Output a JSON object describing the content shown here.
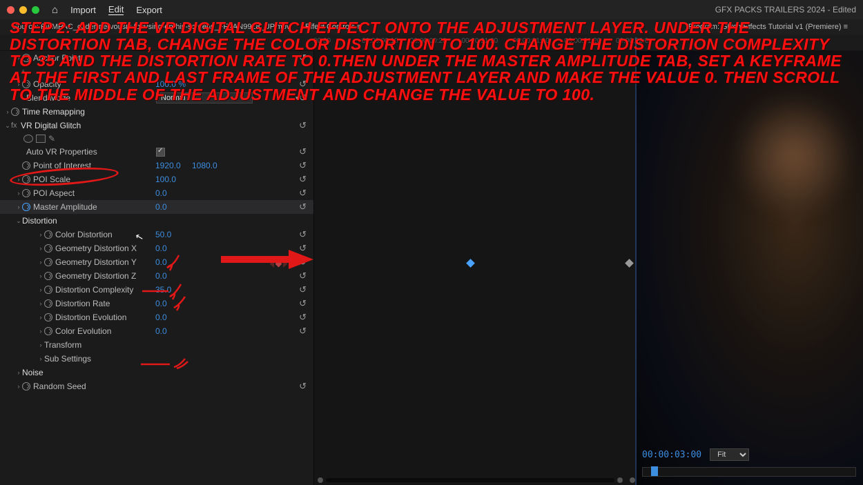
{
  "menu": {
    "import": "Import",
    "edit": "Edit",
    "export": "Export"
  },
  "docTitle": "GFX PACKS TRAILERS 2024 - Edited",
  "panels": {
    "source": "Source: FILMPAC_coder-nervously-focusing-on-his-screens_FFAAN9928_UP.mov",
    "effectControls": "Effect Controls ≡",
    "program": "Program: Glitch Effects Tutorial v1 (Premiere) ≡"
  },
  "ruler": [
    "00:00",
    "00:00:00:10",
    "00:00:00:20",
    "00:00:01:00",
    "00:00:01:10",
    "00:00:01:20",
    "00:00:02:0"
  ],
  "props": {
    "anchorPoint": "Anchor Point",
    "opacity": {
      "label": "Opacity",
      "value": "100.0 %"
    },
    "blendMode": {
      "label": "Blend Mode",
      "value": "Normal"
    },
    "timeRemap": "Time Remapping",
    "vrGlitch": "VR Digital Glitch",
    "autoVR": "Auto VR Properties",
    "poi": {
      "label": "Point of Interest",
      "x": "1920.0",
      "y": "1080.0"
    },
    "poiScale": {
      "label": "POI Scale",
      "value": "100.0"
    },
    "poiAspect": {
      "label": "POI Aspect",
      "value": "0.0"
    },
    "masterAmp": {
      "label": "Master Amplitude",
      "value": "0.0"
    },
    "distortion": "Distortion",
    "colorDist": {
      "label": "Color Distortion",
      "value": "50.0"
    },
    "geoX": {
      "label": "Geometry Distortion X",
      "value": "0.0"
    },
    "geoY": {
      "label": "Geometry Distortion Y",
      "value": "0.0"
    },
    "geoZ": {
      "label": "Geometry Distortion Z",
      "value": "0.0"
    },
    "distComp": {
      "label": "Distortion Complexity",
      "value": "35.0"
    },
    "distRate": {
      "label": "Distortion Rate",
      "value": "0.0"
    },
    "distEvo": {
      "label": "Distortion Evolution",
      "value": "0.0"
    },
    "colorEvo": {
      "label": "Color Evolution",
      "value": "0.0"
    },
    "transform": "Transform",
    "subSettings": "Sub Settings",
    "noise": "Noise",
    "randomSeed": "Random Seed"
  },
  "preview": {
    "timecode": "00:00:03:00",
    "fit": "Fit"
  },
  "overlay": "STEP 2: ADD THE VR DIGITAL GLITCH EFFECT ONTO THE ADJUSTMENT LAYER. UNDER THE DISTORTION TAB, CHANGE THE COLOR DISTORTION TO 100. CHANGE THE DISTORTION COMPLEXITY TO 35 AND THE DISTORTION RATE TO 0.THEN UNDER THE MASTER AMPLITUDE TAB, SET A KEYFRAME AT THE FIRST AND LAST FRAME OF THE ADJUSTMENT LAYER AND MAKE THE VALUE 0. THEN SCROLL TO THE MIDDLE OF THE ADJUSTMENT AND CHANGE THE VALUE TO 100."
}
